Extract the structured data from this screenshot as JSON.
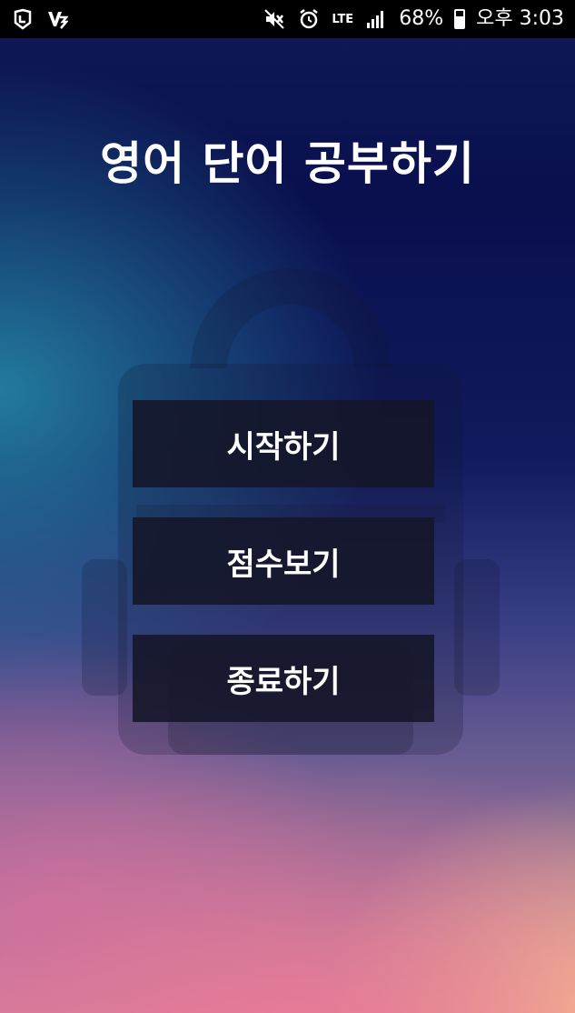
{
  "status_bar": {
    "left_icons": [
      "app-logo-icon",
      "v3-logo-icon"
    ],
    "right_icons": [
      "mute-icon",
      "alarm-icon",
      "lte-icon",
      "signal-icon",
      "battery-icon"
    ],
    "network": "LTE",
    "battery": "68%",
    "time": "오후 3:03"
  },
  "title": "영어 단어 공부하기",
  "menu": {
    "start_label": "시작하기",
    "score_label": "점수보기",
    "exit_label": "종료하기"
  },
  "colors": {
    "button_bg": "#14162a",
    "text": "#ffffff",
    "background_top": "#0a0f4e",
    "background_bottom": "#d88a9a"
  }
}
